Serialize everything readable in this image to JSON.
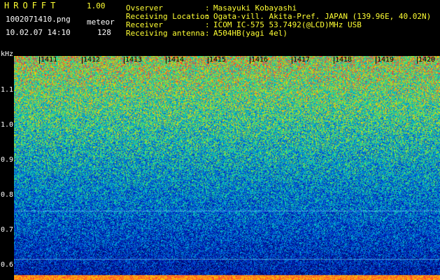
{
  "header": {
    "app_title": "HROFFT",
    "app_version": "1.00",
    "file_name": "1002071410.png",
    "datetime": "10.02.07 14:10",
    "mode_label": "meteor",
    "count": "128",
    "info": [
      {
        "label": "Ovserver",
        "value": "Masayuki Kobayashi"
      },
      {
        "label": "Receiving Location",
        "value": "Ogata-vill. Akita-Pref. JAPAN (139.96E, 40.02N)"
      },
      {
        "label": "Receiver",
        "value": "ICOM IC-575 53.7492(@LCD)MHz USB"
      },
      {
        "label": "Receiving antenna",
        "value": "A504HB(yagi 4el)"
      }
    ],
    "separator": ":"
  },
  "spectrogram": {
    "unit": "kHz",
    "y_ticks": [
      "1.1",
      "1.0",
      "0.9",
      "0.8",
      "0.7",
      "0.6"
    ],
    "x_ticks": [
      "1411",
      "1412",
      "1413",
      "1414",
      "1415",
      "1416",
      "1417",
      "1418",
      "1419",
      "1420"
    ],
    "colors": {
      "label_yellow": "#ffff33",
      "label_white": "#ffffff",
      "label_green": "#33ff33",
      "background": "#000000"
    }
  }
}
